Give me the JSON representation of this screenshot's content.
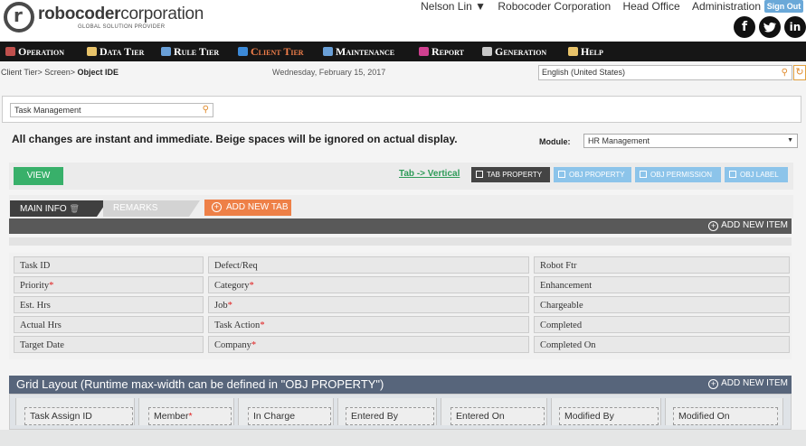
{
  "header": {
    "logo": {
      "robo": "robo",
      "rest": "coder",
      "corp": "corporation",
      "tagline": "GLOBAL SOLUTION PROVIDER"
    },
    "user": "Nelson Lin ▼",
    "company": "Robocoder Corporation",
    "office": "Head Office",
    "admin": "Administration",
    "signout": "Sign Out",
    "social": {
      "facebook": "f",
      "twitter": "t",
      "linkedin": "in"
    }
  },
  "menu": [
    {
      "label": "Operation",
      "icon_color": "#c0504d"
    },
    {
      "label": "Data Tier",
      "icon_color": "#e8c36a"
    },
    {
      "label": "Rule Tier",
      "icon_color": "#6aa0d8"
    },
    {
      "label": "Client Tier",
      "icon_color": "#3c8ad8",
      "active": true
    },
    {
      "label": "Maintenance",
      "icon_color": "#6aa0d8"
    },
    {
      "label": "Report",
      "icon_color": "#d04090"
    },
    {
      "label": "Generation",
      "icon_color": "#c8c8c8"
    },
    {
      "label": "Help",
      "icon_color": "#e8c36a"
    }
  ],
  "breadcrumb": {
    "path": "Client Tier> Screen> ",
    "current": "Object IDE"
  },
  "date": "Wednesday, February 15, 2017",
  "language": {
    "value": "English (United States)"
  },
  "search": {
    "value": "Task Management"
  },
  "notice": "All changes are instant and immediate. Beige spaces will be ignored on actual display.",
  "module": {
    "label": "Module:",
    "value": "HR Management"
  },
  "toolbar": {
    "view": "VIEW",
    "tab_vertical": "Tab -> Vertical",
    "buttons": [
      "TAB PROPERTY",
      "OBJ PROPERTY",
      "OBJ PERMISSION",
      "OBJ LABEL"
    ]
  },
  "tabs": {
    "main": "MAIN INFO",
    "remarks": "REMARKS",
    "add_tab": "ADD NEW TAB"
  },
  "add_item": "ADD NEW ITEM",
  "form_rows": [
    [
      {
        "label": "Task ID"
      },
      {
        "label": "Defect/Req"
      },
      {
        "label": "Robot Ftr"
      }
    ],
    [
      {
        "label": "Priority",
        "req": "*"
      },
      {
        "label": "Category",
        "req": "*"
      },
      {
        "label": "Enhancement"
      }
    ],
    [
      {
        "label": "Est. Hrs"
      },
      {
        "label": "Job",
        "req": "*"
      },
      {
        "label": "Chargeable"
      }
    ],
    [
      {
        "label": "Actual Hrs"
      },
      {
        "label": "Task Action",
        "req": "*"
      },
      {
        "label": "Completed"
      }
    ],
    [
      {
        "label": "Target Date"
      },
      {
        "label": "Company",
        "req": "*"
      },
      {
        "label": "Completed On"
      }
    ]
  ],
  "grid_layout": {
    "title": "Grid Layout (Runtime max-width can be defined in \"OBJ PROPERTY\")",
    "columns": [
      {
        "label": "Task Assign ID"
      },
      {
        "label": "Member",
        "req": "*"
      },
      {
        "label": "In Charge"
      },
      {
        "label": "Entered By"
      },
      {
        "label": "Entered On"
      },
      {
        "label": "Modified By"
      },
      {
        "label": "Modified On"
      }
    ]
  }
}
